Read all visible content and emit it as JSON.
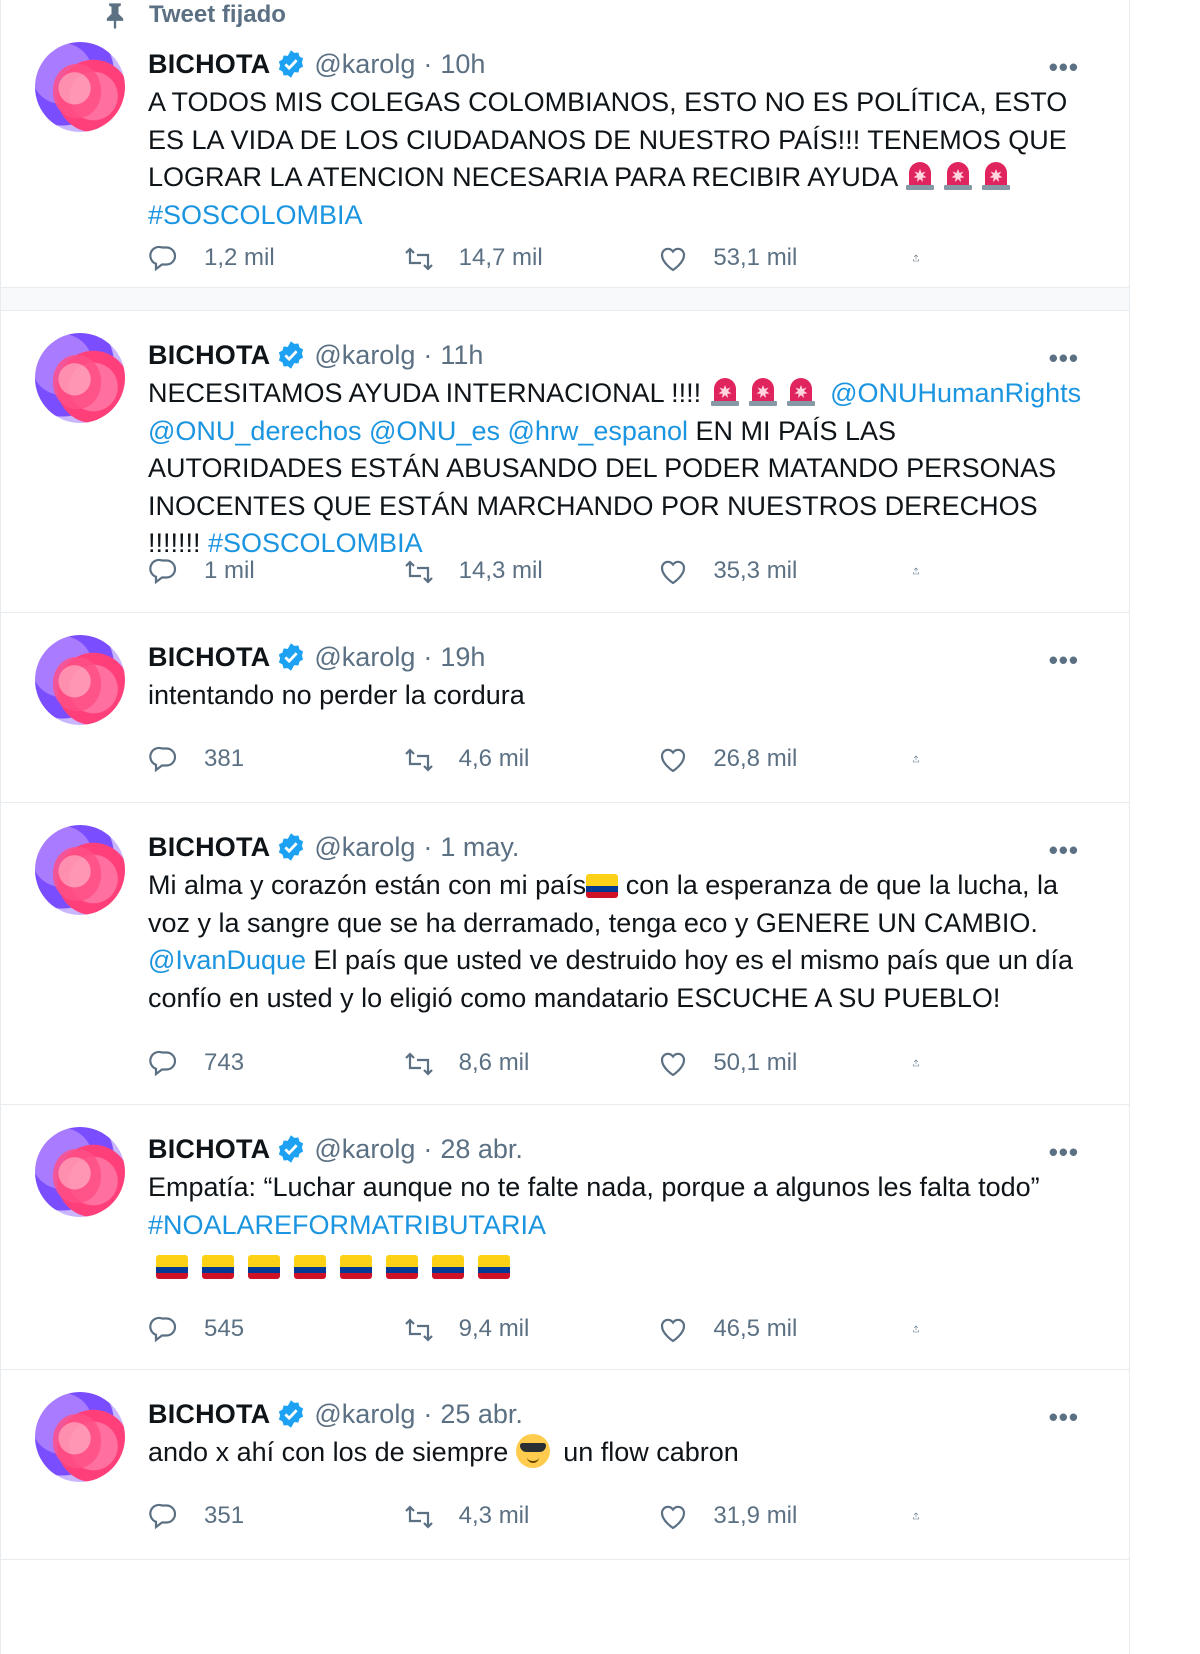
{
  "pinned_label": "Tweet fijado",
  "tweets": [
    {
      "name": "BICHOTA",
      "handle": "@karolg",
      "time": "10h",
      "body_parts": [
        {
          "t": "A TODOS MIS COLEGAS COLOMBIANOS, ESTO NO ES POLÍTICA, ESTO ES LA VIDA DE LOS CIUDADANOS DE NUESTRO PAÍS!!! TENEMOS QUE LOGRAR LA ATENCION NECESARIA PARA RECIBIR AYUDA ",
          "k": "text"
        },
        {
          "k": "siren"
        },
        {
          "k": "siren"
        },
        {
          "k": "siren"
        },
        {
          "t": " ",
          "k": "text"
        },
        {
          "t": "#SOSCOLOMBIA",
          "k": "link"
        }
      ],
      "replies": "1,2 mil",
      "retweets": "14,7 mil",
      "likes": "53,1 mil"
    },
    {
      "name": "BICHOTA",
      "handle": "@karolg",
      "time": "11h",
      "body_parts": [
        {
          "t": "NECESITAMOS AYUDA INTERNACIONAL !!!!  ",
          "k": "text"
        },
        {
          "k": "siren"
        },
        {
          "k": "siren"
        },
        {
          "k": "siren"
        },
        {
          "t": " ",
          "k": "text"
        },
        {
          "t": "@ONUHumanRights",
          "k": "link"
        },
        {
          "t": " ",
          "k": "text"
        },
        {
          "t": "@ONU_derechos",
          "k": "link"
        },
        {
          "t": " ",
          "k": "text"
        },
        {
          "t": "@ONU_es",
          "k": "link"
        },
        {
          "t": " ",
          "k": "text"
        },
        {
          "t": "@hrw_espanol",
          "k": "link"
        },
        {
          "t": " EN MI PAÍS LAS AUTORIDADES ESTÁN ABUSANDO DEL PODER MATANDO PERSONAS INOCENTES QUE ESTÁN MARCHANDO POR NUESTROS DERECHOS !!!!!!! ",
          "k": "text"
        },
        {
          "t": "#SOSCOLOMBIA",
          "k": "link"
        }
      ],
      "replies": "1 mil",
      "retweets": "14,3 mil",
      "likes": "35,3 mil"
    },
    {
      "name": "BICHOTA",
      "handle": "@karolg",
      "time": "19h",
      "body_parts": [
        {
          "t": "intentando no perder la cordura",
          "k": "text"
        }
      ],
      "replies": "381",
      "retweets": "4,6 mil",
      "likes": "26,8 mil"
    },
    {
      "name": "BICHOTA",
      "handle": "@karolg",
      "time": "1 may.",
      "body_parts": [
        {
          "t": "Mi alma y corazón están con mi país",
          "k": "text"
        },
        {
          "k": "flag-inline"
        },
        {
          "t": " con la esperanza de que la lucha, la voz y la sangre que se ha derramado, tenga eco y GENERE UN CAMBIO. ",
          "k": "text"
        },
        {
          "t": "@IvanDuque",
          "k": "link"
        },
        {
          "t": " El país que usted ve destruido hoy es el mismo país que un día confío en usted y lo eligió como mandatario ESCUCHE A SU PUEBLO!",
          "k": "text"
        }
      ],
      "replies": "743",
      "retweets": "8,6 mil",
      "likes": "50,1 mil"
    },
    {
      "name": "BICHOTA",
      "handle": "@karolg",
      "time": "28 abr.",
      "body_parts": [
        {
          "t": "Empatía: “Luchar aunque no te falte nada, porque a algunos les falta todo”",
          "k": "text"
        },
        {
          "k": "br"
        },
        {
          "t": "#NOALAREFORMATRIBUTARIA",
          "k": "link"
        },
        {
          "k": "br"
        },
        {
          "k": "flagrow",
          "n": 8
        }
      ],
      "replies": "545",
      "retweets": "9,4 mil",
      "likes": "46,5 mil"
    },
    {
      "name": "BICHOTA",
      "handle": "@karolg",
      "time": "25 abr.",
      "body_parts": [
        {
          "t": "ando x ahí con los de siempre ",
          "k": "text"
        },
        {
          "k": "sunglasses"
        },
        {
          "t": " un flow cabron",
          "k": "text"
        }
      ],
      "replies": "351",
      "retweets": "4,3 mil",
      "likes": "31,9 mil"
    }
  ]
}
